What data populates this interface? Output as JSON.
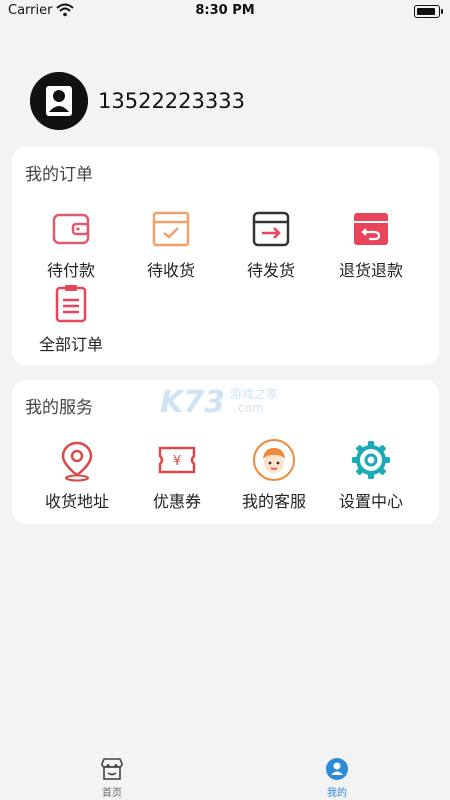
{
  "status_bar": {
    "carrier": "Carrier",
    "time": "8:30 PM"
  },
  "profile": {
    "phone": "13522223333"
  },
  "orders": {
    "title": "我的订单",
    "items": [
      {
        "label": "待付款",
        "icon": "wallet-icon",
        "color": "#e0596e"
      },
      {
        "label": "待收货",
        "icon": "box-icon",
        "color": "#f0a06a"
      },
      {
        "label": "待发货",
        "icon": "ship-box-icon",
        "color": "#333333"
      },
      {
        "label": "退货退款",
        "icon": "return-box-icon",
        "color": "#e8455a"
      },
      {
        "label": "全部订单",
        "icon": "clipboard-icon",
        "color": "#e8455a"
      }
    ]
  },
  "services": {
    "title": "我的服务",
    "items": [
      {
        "label": "收货地址",
        "icon": "location-pin-icon",
        "color": "#d94a4a"
      },
      {
        "label": "优惠券",
        "icon": "coupon-icon",
        "color": "#d94a4a"
      },
      {
        "label": "我的客服",
        "icon": "customer-service-icon",
        "color": "#f08a3a"
      },
      {
        "label": "设置中心",
        "icon": "gear-icon",
        "color": "#1aabb8"
      }
    ]
  },
  "watermark": {
    "brand": "K73",
    "cn": "游戏之家",
    "domain": ".com"
  },
  "tabbar": {
    "tabs": [
      {
        "label": "首页",
        "icon": "store-icon",
        "active": false
      },
      {
        "label": "我的",
        "icon": "user-icon",
        "active": true,
        "color": "#2c8ad6"
      }
    ]
  }
}
